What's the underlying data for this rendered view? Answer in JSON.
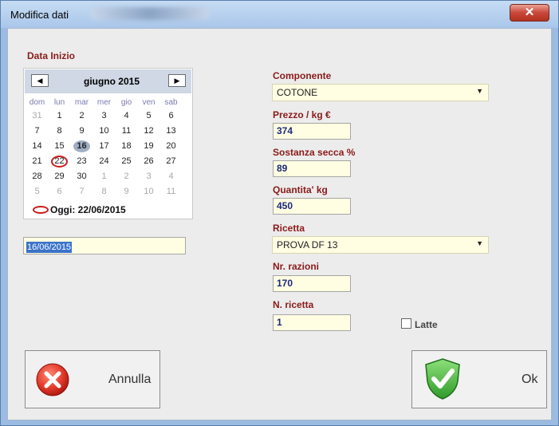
{
  "window": {
    "title": "Modifica dati"
  },
  "calendar": {
    "section_label": "Data Inizio",
    "month_label": "giugno 2015",
    "prev_label": "◀",
    "next_label": "▶",
    "weekdays": [
      "dom",
      "lun",
      "mar",
      "mer",
      "gio",
      "ven",
      "sab"
    ],
    "weeks": [
      [
        "31",
        "1",
        "2",
        "3",
        "4",
        "5",
        "6"
      ],
      [
        "7",
        "8",
        "9",
        "10",
        "11",
        "12",
        "13"
      ],
      [
        "14",
        "15",
        "16",
        "17",
        "18",
        "19",
        "20"
      ],
      [
        "21",
        "22",
        "23",
        "24",
        "25",
        "26",
        "27"
      ],
      [
        "28",
        "29",
        "30",
        "1",
        "2",
        "3",
        "4"
      ],
      [
        "5",
        "6",
        "7",
        "8",
        "9",
        "10",
        "11"
      ]
    ],
    "selected_day": "16",
    "today_day": "22",
    "today_text": "Oggi: 22/06/2015",
    "date_field_value": "16/06/2015"
  },
  "form": {
    "componente_label": "Componente",
    "componente_value": "COTONE",
    "prezzo_label": "Prezzo / kg  €",
    "prezzo_value": "374",
    "sostanza_label": "Sostanza secca %",
    "sostanza_value": "89",
    "quantita_label": "Quantita' kg",
    "quantita_value": "450",
    "ricetta_label": "Ricetta",
    "ricetta_value": "PROVA DF 13",
    "razioni_label": "Nr. razioni",
    "razioni_value": "170",
    "nricetta_label": "N. ricetta",
    "nricetta_value": "1",
    "latte_label": "Latte"
  },
  "buttons": {
    "cancel_label": "Annulla",
    "ok_label": "Ok"
  },
  "colors": {
    "label_red": "#8b1a1a",
    "field_bg": "#fffde2",
    "selection_blue": "#3b73c9"
  }
}
